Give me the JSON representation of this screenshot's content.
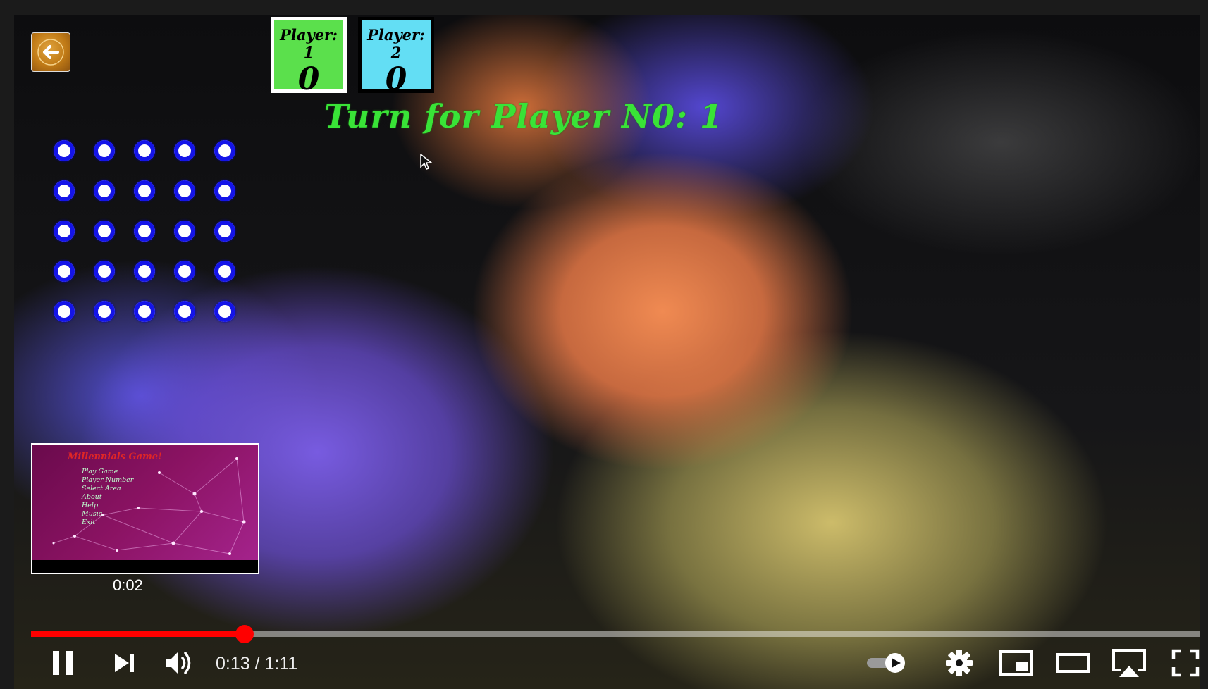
{
  "game": {
    "player1": {
      "label": "Player: 1",
      "score": "0",
      "color": "#5be04c"
    },
    "player2": {
      "label": "Player: 2",
      "score": "0",
      "color": "#63def4"
    },
    "turn_text": "Turn for Player N0: 1",
    "grid": {
      "rows": 5,
      "cols": 5,
      "dot_color": "#1414e8"
    }
  },
  "preview": {
    "time": "0:02",
    "title": "Millennials Game!",
    "menu": [
      "Play Game",
      "Player Number",
      "Select Area",
      "About",
      "Help",
      "Music",
      "Exit"
    ]
  },
  "player": {
    "current_time": "0:13",
    "separator": "/",
    "duration": "1:11",
    "progress_fraction": 0.183,
    "accent": "#ff0000"
  }
}
